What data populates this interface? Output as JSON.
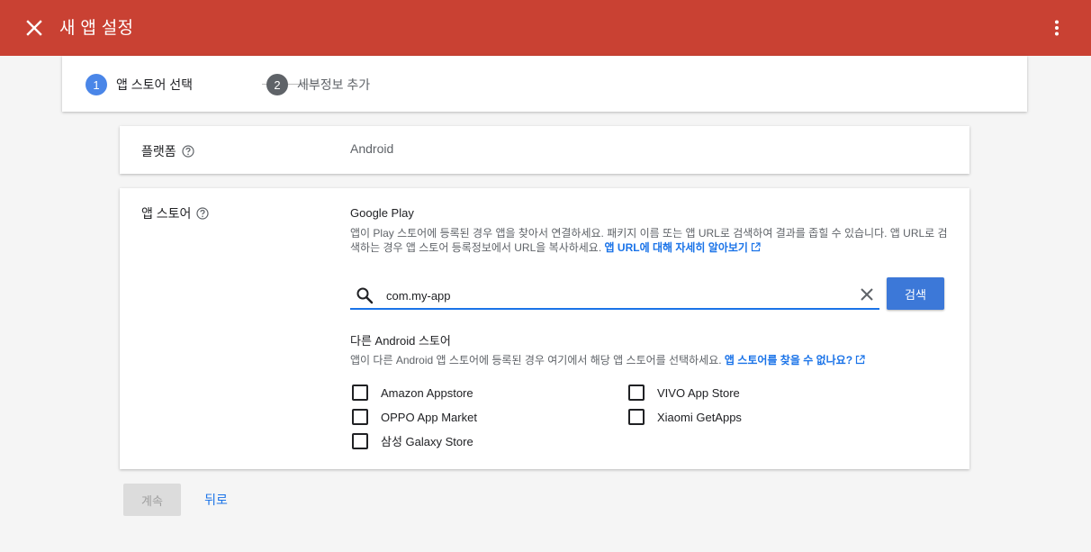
{
  "header": {
    "title": "새 앱 설정",
    "background_color": "#c94133"
  },
  "stepper": {
    "steps": [
      {
        "number": "1",
        "label": "앱 스토어 선택",
        "active": true
      },
      {
        "number": "2",
        "label": "세부정보 추가",
        "active": false
      }
    ],
    "active_color": "#4a86e8",
    "inactive_color": "#5f6368"
  },
  "platform": {
    "label": "플랫폼",
    "value": "Android"
  },
  "app_store": {
    "label": "앱 스토어",
    "google_play": {
      "title": "Google Play",
      "description": "앱이 Play 스토어에 등록된 경우 앱을 찾아서 연결하세요. 패키지 이름 또는 앱 URL로 검색하여 결과를 좁힐 수 있습니다. 앱 URL로 검색하는 경우 앱 스토어 등록정보에서 URL을 복사하세요.",
      "link_text": "앱 URL에 대해 자세히 알아보기"
    },
    "search": {
      "value": "com.my-app",
      "button_label": "검색"
    },
    "other_stores": {
      "title": "다른 Android 스토어",
      "description": "앱이 다른 Android 앱 스토어에 등록된 경우 여기에서 해당 앱 스토어를 선택하세요.",
      "link_text": "앱 스토어를 찾을 수 없나요?",
      "options": [
        {
          "label": "Amazon Appstore",
          "checked": false
        },
        {
          "label": "OPPO App Market",
          "checked": false
        },
        {
          "label": "삼성 Galaxy Store",
          "checked": false
        },
        {
          "label": "VIVO App Store",
          "checked": false
        },
        {
          "label": "Xiaomi GetApps",
          "checked": false
        }
      ]
    }
  },
  "footer": {
    "continue_label": "계속",
    "back_label": "뒤로"
  },
  "colors": {
    "accent": "#1a73e8",
    "button_primary": "#3c78d8"
  }
}
